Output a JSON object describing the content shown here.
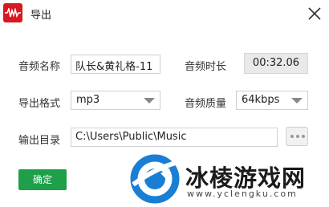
{
  "window": {
    "title": "导出"
  },
  "icons": {
    "app": "audio-waveform-icon",
    "close": "close-icon",
    "more": "more-dots-icon",
    "watermark": "watermark-logo-icon"
  },
  "form": {
    "audio_name_label": "音频名称",
    "audio_name_value": "队长&黄礼格-11",
    "duration_label": "音频时长",
    "duration_value": "00:32.06",
    "format_label": "导出格式",
    "format_value": "mp3",
    "quality_label": "音频质量",
    "quality_value": "64kbps",
    "output_dir_label": "输出目录",
    "output_dir_value": "C:\\Users\\Public\\Music"
  },
  "buttons": {
    "ok": "确定"
  },
  "watermark": {
    "text": "冰棱游戏网",
    "url": "www.yclengku.com"
  },
  "colors": {
    "accent_green": "#1e9f4a",
    "brand_red": "#d71920",
    "watermark_blue": "#1a7fd4"
  }
}
